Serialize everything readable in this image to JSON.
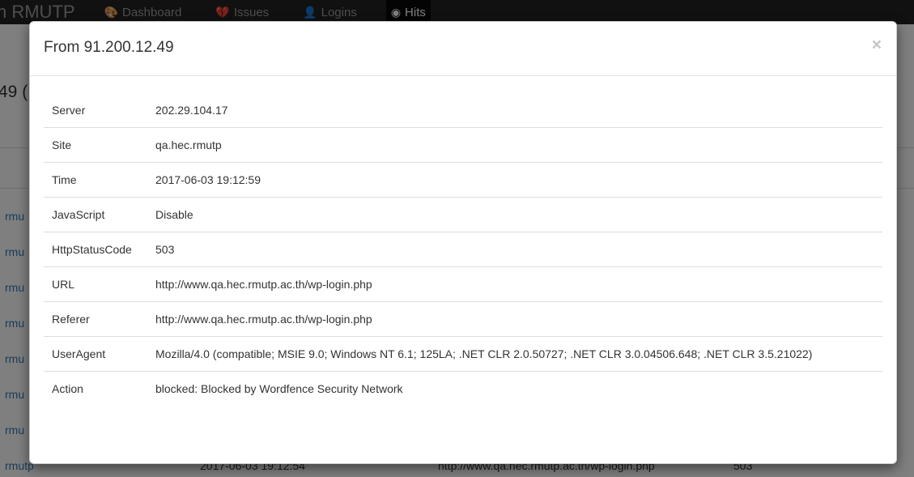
{
  "navbar": {
    "brand": "n RMUTP",
    "items": [
      {
        "label": "Dashboard",
        "icon": "dashboard-icon",
        "glyph": "🎨",
        "active": false
      },
      {
        "label": "Issues",
        "icon": "heartbeat-icon",
        "glyph": "💔",
        "active": false
      },
      {
        "label": "Logins",
        "icon": "user-icon",
        "glyph": "👤",
        "active": false
      },
      {
        "label": "Hits",
        "icon": "hits-icon",
        "glyph": "◉",
        "active": true
      }
    ]
  },
  "background": {
    "heading_fragment": "49 (",
    "rows": [
      {
        "site": "rmu"
      },
      {
        "site": "rmu"
      },
      {
        "site": "rmu"
      },
      {
        "site": "rmu"
      },
      {
        "site": "rmu"
      },
      {
        "site": "rmu"
      },
      {
        "site": "rmu"
      },
      {
        "site": "rmutp",
        "time": "2017-06-03 19:12:54",
        "url": "http://www.qa.hec.rmutp.ac.th/wp-login.php",
        "code": "503"
      }
    ]
  },
  "modal": {
    "title": "From 91.200.12.49",
    "close_glyph": "×",
    "rows": [
      {
        "key": "Server",
        "value": "202.29.104.17",
        "danger": false
      },
      {
        "key": "Site",
        "value": "qa.hec.rmutp",
        "danger": false
      },
      {
        "key": "Time",
        "value": "2017-06-03 19:12:59",
        "danger": false
      },
      {
        "key": "JavaScript",
        "value": "Disable",
        "danger": true
      },
      {
        "key": "HttpStatusCode",
        "value": "503",
        "danger": true
      },
      {
        "key": "URL",
        "value": "http://www.qa.hec.rmutp.ac.th/wp-login.php",
        "danger": false
      },
      {
        "key": "Referer",
        "value": "http://www.qa.hec.rmutp.ac.th/wp-login.php",
        "danger": false
      },
      {
        "key": "UserAgent",
        "value": "Mozilla/4.0 (compatible; MSIE 9.0; Windows NT 6.1; 125LA; .NET CLR 2.0.50727; .NET CLR 3.0.04506.648; .NET CLR 3.5.21022)",
        "danger": false
      },
      {
        "key": "Action",
        "value": "blocked: Blocked by Wordfence Security Network",
        "danger": false
      }
    ]
  },
  "colors": {
    "danger": "#a94442",
    "link": "#337ab7",
    "navbar": "#222222"
  }
}
